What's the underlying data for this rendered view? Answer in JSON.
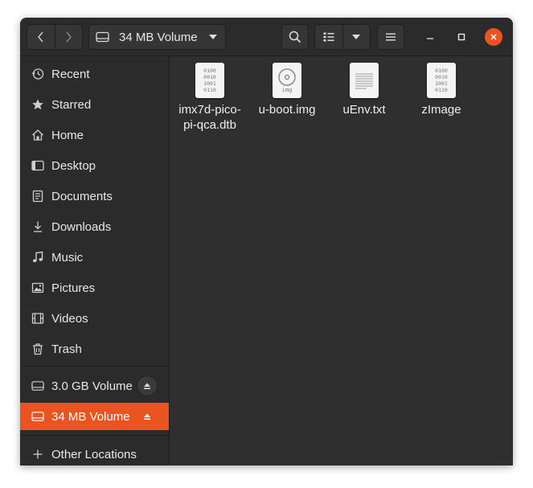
{
  "header": {
    "location_label": "34 MB Volume",
    "icons": {
      "back": "chevron-left-icon",
      "forward": "chevron-right-icon",
      "drive": "drive-icon",
      "dropdown": "triangle-down-icon",
      "search": "search-icon",
      "list_view": "list-view-icon",
      "view_options": "triangle-down-icon",
      "menu": "hamburger-menu-icon",
      "minimize": "minimize-icon",
      "maximize": "maximize-icon",
      "close": "close-icon"
    },
    "close_color": "#e95420"
  },
  "sidebar": {
    "accent": "#e95420",
    "places": [
      {
        "label": "Recent",
        "icon": "clock-icon"
      },
      {
        "label": "Starred",
        "icon": "star-icon"
      },
      {
        "label": "Home",
        "icon": "home-icon"
      },
      {
        "label": "Desktop",
        "icon": "desktop-icon"
      },
      {
        "label": "Documents",
        "icon": "document-icon"
      },
      {
        "label": "Downloads",
        "icon": "download-icon"
      },
      {
        "label": "Music",
        "icon": "music-icon"
      },
      {
        "label": "Pictures",
        "icon": "picture-icon"
      },
      {
        "label": "Videos",
        "icon": "film-icon"
      },
      {
        "label": "Trash",
        "icon": "trash-icon"
      }
    ],
    "volumes": [
      {
        "label": "3.0 GB Volume",
        "icon": "drive-icon",
        "active": false
      },
      {
        "label": "34 MB Volume",
        "icon": "drive-icon",
        "active": true
      }
    ],
    "other_locations": {
      "label": "Other Locations",
      "icon": "plus-icon"
    }
  },
  "files": [
    {
      "name": "imx7d-pico-pi-qca.dtb",
      "type": "binary",
      "binary_lines": [
        "0100",
        "0010",
        "1001",
        "0110"
      ]
    },
    {
      "name": "u-boot.img",
      "type": "disk-image",
      "badge": "img"
    },
    {
      "name": "uEnv.txt",
      "type": "text"
    },
    {
      "name": "zImage",
      "type": "binary",
      "binary_lines": [
        "0100",
        "0010",
        "1001",
        "0110"
      ]
    }
  ]
}
